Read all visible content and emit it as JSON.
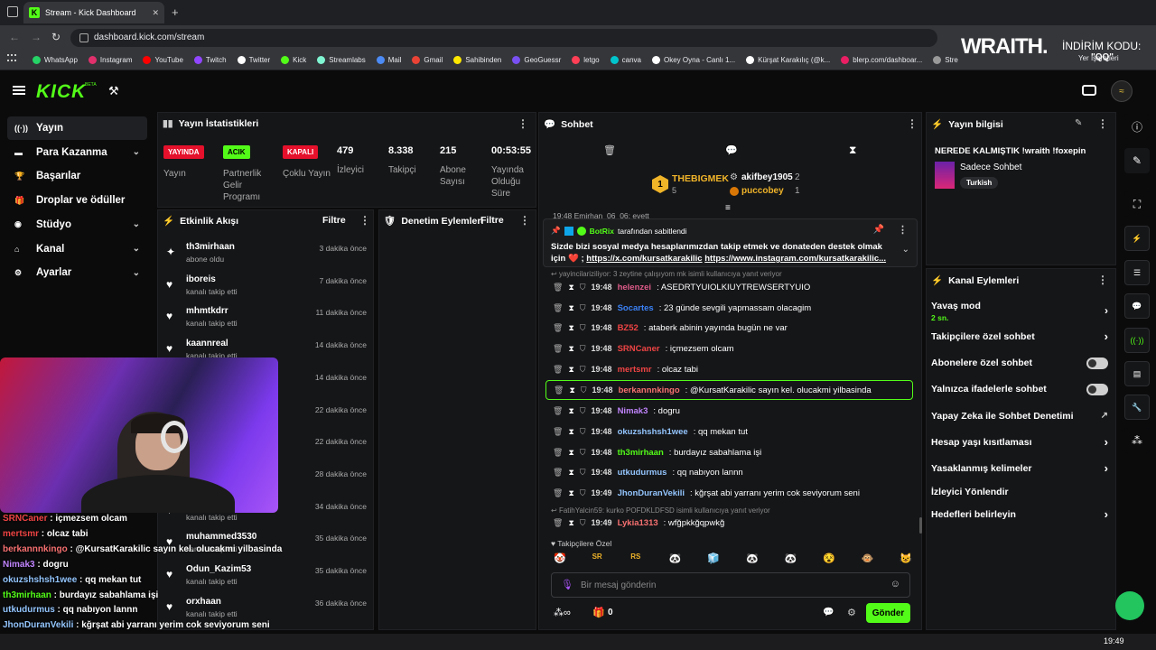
{
  "browser": {
    "tab_title": "Stream - Kick Dashboard",
    "url": "dashboard.kick.com/stream",
    "bookmarks": [
      {
        "label": "WhatsApp",
        "color": "#25d366"
      },
      {
        "label": "Instagram",
        "color": "#e1306c"
      },
      {
        "label": "YouTube",
        "color": "#ff0000"
      },
      {
        "label": "Twitch",
        "color": "#9146ff"
      },
      {
        "label": "Twitter",
        "color": "#ffffff"
      },
      {
        "label": "Kick",
        "color": "#53fc18"
      },
      {
        "label": "Streamlabs",
        "color": "#80f5d2"
      },
      {
        "label": "Mail",
        "color": "#4c8bf5"
      },
      {
        "label": "Gmail",
        "color": "#ea4335"
      },
      {
        "label": "Sahibinden",
        "color": "#ffe800"
      },
      {
        "label": "GeoGuessr",
        "color": "#7950f2"
      },
      {
        "label": "letgo",
        "color": "#ff3f55"
      },
      {
        "label": "canva",
        "color": "#00c4cc"
      },
      {
        "label": "Okey Oyna - Canlı 1...",
        "color": "#ffffff"
      },
      {
        "label": "Kürşat Karakılıç (@k...",
        "color": "#ffffff"
      },
      {
        "label": "blerp.com/dashboar...",
        "color": "#e91e63"
      },
      {
        "label": "Stre",
        "color": "#999999"
      }
    ],
    "other_bookmarks": "Yer İşaretleri"
  },
  "overlay": {
    "brand": "WRAITH.",
    "discount": "İNDİRİM KODU:",
    "code": "\"QQ\""
  },
  "kick": {
    "logo": "KICK",
    "beta": "BETA"
  },
  "sidebar": [
    {
      "label": "Yayın",
      "icon": "live-icon",
      "expand": false,
      "active": true
    },
    {
      "label": "Para Kazanma",
      "icon": "money-icon",
      "expand": true
    },
    {
      "label": "Başarılar",
      "icon": "trophy-icon",
      "expand": false
    },
    {
      "label": "Droplar ve ödüller",
      "icon": "gift-icon",
      "expand": false
    },
    {
      "label": "Stüdyo",
      "icon": "studio-icon",
      "expand": true
    },
    {
      "label": "Kanal",
      "icon": "channel-icon",
      "expand": true
    },
    {
      "label": "Ayarlar",
      "icon": "gear-icon",
      "expand": true
    }
  ],
  "stats": {
    "title": "Yayın İstatistikleri",
    "badges": [
      {
        "text": "YAYINDA",
        "label": "Yayın",
        "color": "#e5102b",
        "text_color": "#ffffff"
      },
      {
        "text": "ACIK",
        "label": "Partnerlik Gelir Programı",
        "color": "#53fc18",
        "text_color": "#000000"
      },
      {
        "text": "KAPALI",
        "label": "Çoklu Yayın",
        "color": "#e5102b",
        "text_color": "#ffffff"
      }
    ],
    "numbers": [
      {
        "value": "479",
        "label": "İzleyici"
      },
      {
        "value": "8.338",
        "label": "Takipçi"
      },
      {
        "value": "215",
        "label": "Abone Sayısı"
      },
      {
        "value": "00:53:55",
        "label": "Yayında Olduğu Süre"
      }
    ]
  },
  "activity": {
    "title": "Etkinlik Akışı",
    "filter": "Filtre",
    "items": [
      {
        "name": "th3mirhaan",
        "sub": "abone oldu",
        "time": "3 dakika önce",
        "icon": "star"
      },
      {
        "name": "iboreis",
        "sub": "kanalı takip etti",
        "time": "7 dakika önce",
        "icon": "heart"
      },
      {
        "name": "mhmtkdrr",
        "sub": "kanalı takip etti",
        "time": "11 dakika önce",
        "icon": "heart"
      },
      {
        "name": "kaannreal",
        "sub": "kanalı takip etti",
        "time": "14 dakika önce",
        "icon": "heart"
      },
      {
        "name": "",
        "sub": "",
        "time": "14 dakika önce",
        "icon": "heart"
      },
      {
        "name": "",
        "sub": "",
        "time": "22 dakika önce",
        "icon": "heart"
      },
      {
        "name": "",
        "sub": "",
        "time": "22 dakika önce",
        "icon": "heart"
      },
      {
        "name": "",
        "sub": "",
        "time": "28 dakika önce",
        "icon": "heart"
      },
      {
        "name": "",
        "sub": "kanalı takip etti",
        "time": "34 dakika önce",
        "icon": "heart"
      },
      {
        "name": "muhammed3530",
        "sub": "kanalı takip etti",
        "time": "35 dakika önce",
        "icon": "heart"
      },
      {
        "name": "Odun_Kazim53",
        "sub": "kanalı takip etti",
        "time": "35 dakika önce",
        "icon": "heart"
      },
      {
        "name": "orxhaan",
        "sub": "kanalı takip etti",
        "time": "36 dakika önce",
        "icon": "heart"
      }
    ]
  },
  "moderation": {
    "title": "Denetim Eylemleri",
    "filter": "Filtre"
  },
  "chat": {
    "title": "Sohbet",
    "leaders": {
      "first_name": "THEBIGMEK",
      "first_rank": "1",
      "first_count": "5",
      "second_name": "akifbey1905",
      "second_count": "2",
      "third_name": "puccobey",
      "third_count": "1"
    },
    "partial_line": "19:48 Emirhan_06_06: evett",
    "pinned": {
      "by": "BotRix",
      "pinned_text": "tarafından sabitlendi",
      "text": "Sizde bizi sosyal medya hesaplarımızdan takip etmek ve donateden destek olmak için ❤️ ;",
      "link1": "https://x.com/kursatkarakilic",
      "link2": "https://www.instagram.com/kursatkarakilic..."
    },
    "reply_note": "yayincilariziliyor: 3 zeytine çalışıyom mk isimli kullanıcıya yanıt veriyor",
    "messages": [
      {
        "time": "19:48",
        "user": "helenzei",
        "color": "#e05b8a",
        "text": "ASEDRTYUIOLKIUYTREWSERTYUIO"
      },
      {
        "time": "19:48",
        "user": "Socartes",
        "color": "#3b82f6",
        "text": "23 günde sevgili yapmassam olacagim"
      },
      {
        "time": "19:48",
        "user": "BZ52",
        "color": "#ef4444",
        "text": "ataberk abinin yayında bugün ne var"
      },
      {
        "time": "19:48",
        "user": "SRNCaner",
        "color": "#ef4444",
        "text": "içmezsem olcam"
      },
      {
        "time": "19:48",
        "user": "mertsmr",
        "color": "#ef4444",
        "text": "olcaz tabi"
      },
      {
        "time": "19:48",
        "user": "berkannnkingo",
        "color": "#f87171",
        "text": "@KursatKarakilic sayın kel. olucakmi yilbasinda",
        "highlight": true
      },
      {
        "time": "19:48",
        "user": "Nimak3",
        "color": "#c084fc",
        "text": "dogru"
      },
      {
        "time": "19:48",
        "user": "okuzshshsh1wee",
        "color": "#93c5fd",
        "text": "qq mekan tut"
      },
      {
        "time": "19:48",
        "user": "th3mirhaan",
        "color": "#53fc18",
        "text": "burdayız sabahlama işi"
      },
      {
        "time": "19:48",
        "user": "utkudurmus",
        "color": "#93c5fd",
        "text": "qq nabıyon lannn"
      },
      {
        "time": "19:49",
        "user": "JhonDuranVekili",
        "color": "#93c5fd",
        "text": "kğrşat abi yarranı yerim cok seviyorum seni"
      }
    ],
    "reply_note2": "FatihYalcin59: kurko POFDKLDFSD isimli kullanıcıya yanıt veriyor",
    "last": {
      "time": "19:49",
      "user": "Lykia1313",
      "color": "#f87171",
      "text": "wfğpkkğqpwkğ"
    },
    "followers_only": "Takipçilere Özel",
    "emotes": [
      "🤡",
      "SR",
      "RS",
      "🐼",
      "🧊",
      "🐼",
      "🐼",
      "😵",
      "🐵",
      "😺"
    ],
    "placeholder": "Bir mesaj gönderin",
    "points": "0",
    "send": "Gönder"
  },
  "info": {
    "title": "Yayın bilgisi",
    "stream_title": "NEREDE KALMIŞTIK !wraith !foxepin",
    "category": "Sadece Sohbet",
    "tag": "Turkish"
  },
  "channel_actions": {
    "title": "Kanal Eylemleri",
    "slow_mode": "Yavaş mod",
    "slow_value": "2 sn.",
    "items": [
      {
        "label": "Takipçilere özel sohbet",
        "type": "chevron"
      },
      {
        "label": "Abonelere özel sohbet",
        "type": "toggle"
      },
      {
        "label": "Yalnızca ifadelerle sohbet",
        "type": "toggle"
      },
      {
        "label": "Yapay Zeka ile Sohbet Denetimi",
        "type": "external"
      },
      {
        "label": "Hesap yaşı kısıtlaması",
        "type": "chevron"
      },
      {
        "label": "Yasaklanmış kelimeler",
        "type": "chevron"
      },
      {
        "label": "İzleyici Yönlendir",
        "type": "none"
      },
      {
        "label": "Hedefleri belirleyin",
        "type": "chevron"
      }
    ]
  },
  "overlay_chat": [
    {
      "user": "SRNCaner",
      "color": "#ef4444",
      "text": "içmezsem olcam"
    },
    {
      "user": "mertsmr",
      "color": "#ef4444",
      "text": "olcaz tabi"
    },
    {
      "user": "berkannnkingo",
      "color": "#f87171",
      "text": "@KursatKarakilic sayın kel. olucakmi yilbasinda"
    },
    {
      "user": "Nimak3",
      "color": "#c084fc",
      "text": "dogru"
    },
    {
      "user": "okuzshshsh1wee",
      "color": "#93c5fd",
      "text": "qq mekan tut"
    },
    {
      "user": "th3mirhaan",
      "color": "#53fc18",
      "text": "burdayız sabahlama işi"
    },
    {
      "user": "utkudurmus",
      "color": "#93c5fd",
      "text": "qq nabıyon lannn"
    },
    {
      "user": "JhonDuranVekili",
      "color": "#93c5fd",
      "text": "kğrşat abi yarranı yerim cok seviyorum seni"
    },
    {
      "user": "Lykia1313",
      "color": "#f87171",
      "text": "wfğpkkğqpwkğ"
    }
  ],
  "taskbar": {
    "clock": "19:49"
  }
}
